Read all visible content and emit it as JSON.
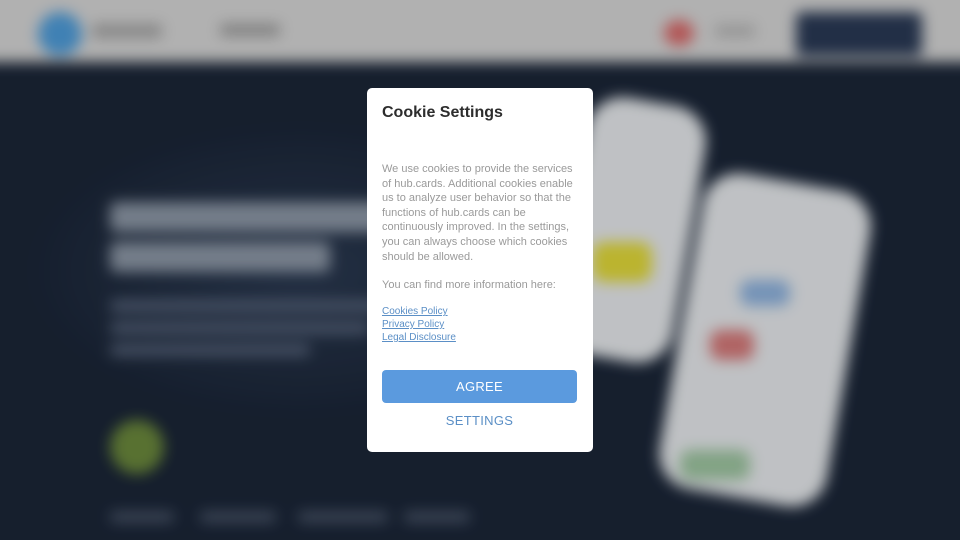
{
  "cookie_modal": {
    "title": "Cookie Settings",
    "body": "We use cookies to provide the services of hub.cards. Additional cookies enable us to analyze user behavior so that the functions of hub.cards can be continuously improved. In the settings, you can always choose which cookies should be allowed.",
    "more_info": "You can find more information here:",
    "links": [
      {
        "label": "Cookies Policy"
      },
      {
        "label": "Privacy Policy"
      },
      {
        "label": "Legal Disclosure"
      }
    ],
    "agree_label": "AGREE",
    "settings_label": "SETTINGS"
  },
  "colors": {
    "primary_button": "#5b9ade",
    "link": "#5b8fc6",
    "overlay_page": "#1b2638"
  }
}
